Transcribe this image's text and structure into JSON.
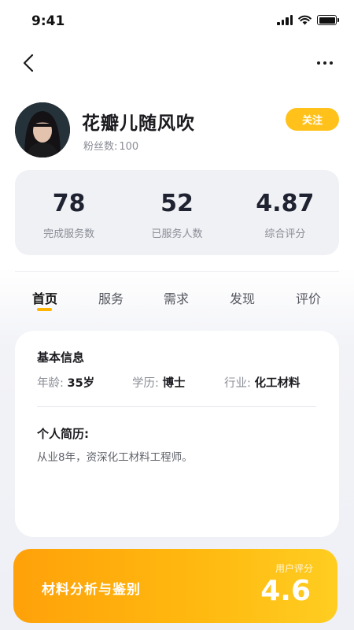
{
  "status_bar": {
    "time": "9:41",
    "icons": [
      "signal-icon",
      "wifi-icon",
      "battery-icon"
    ]
  },
  "nav": {
    "back_icon": "chevron-left-icon",
    "more_icon": "ellipsis-icon"
  },
  "profile": {
    "name": "花瓣儿随风吹",
    "fans_label": "粉丝数:",
    "fans_count": "100",
    "follow_label": "关注"
  },
  "stats": [
    {
      "value": "78",
      "label": "完成服务数"
    },
    {
      "value": "52",
      "label": "已服务人数"
    },
    {
      "value": "4.87",
      "label": "综合评分"
    }
  ],
  "tabs": [
    {
      "label": "首页",
      "active": true
    },
    {
      "label": "服务",
      "active": false
    },
    {
      "label": "需求",
      "active": false
    },
    {
      "label": "发现",
      "active": false
    },
    {
      "label": "评价",
      "active": false
    }
  ],
  "basic_info": {
    "title": "基本信息",
    "age_label": "年龄:",
    "age_value": "35岁",
    "education_label": "学历:",
    "education_value": "博士",
    "industry_label": "行业:",
    "industry_value": "化工材料"
  },
  "resume": {
    "title": "个人简历:",
    "text": "从业8年，资深化工材料工程师。"
  },
  "promo": {
    "title": "材料分析与鉴别",
    "rating_label": "用户评分",
    "rating": "4.6"
  },
  "colors": {
    "accent": "#ffc11a",
    "indicator": "#ffb400",
    "promo_start": "#ffa10a",
    "promo_end": "#ffcd21"
  }
}
